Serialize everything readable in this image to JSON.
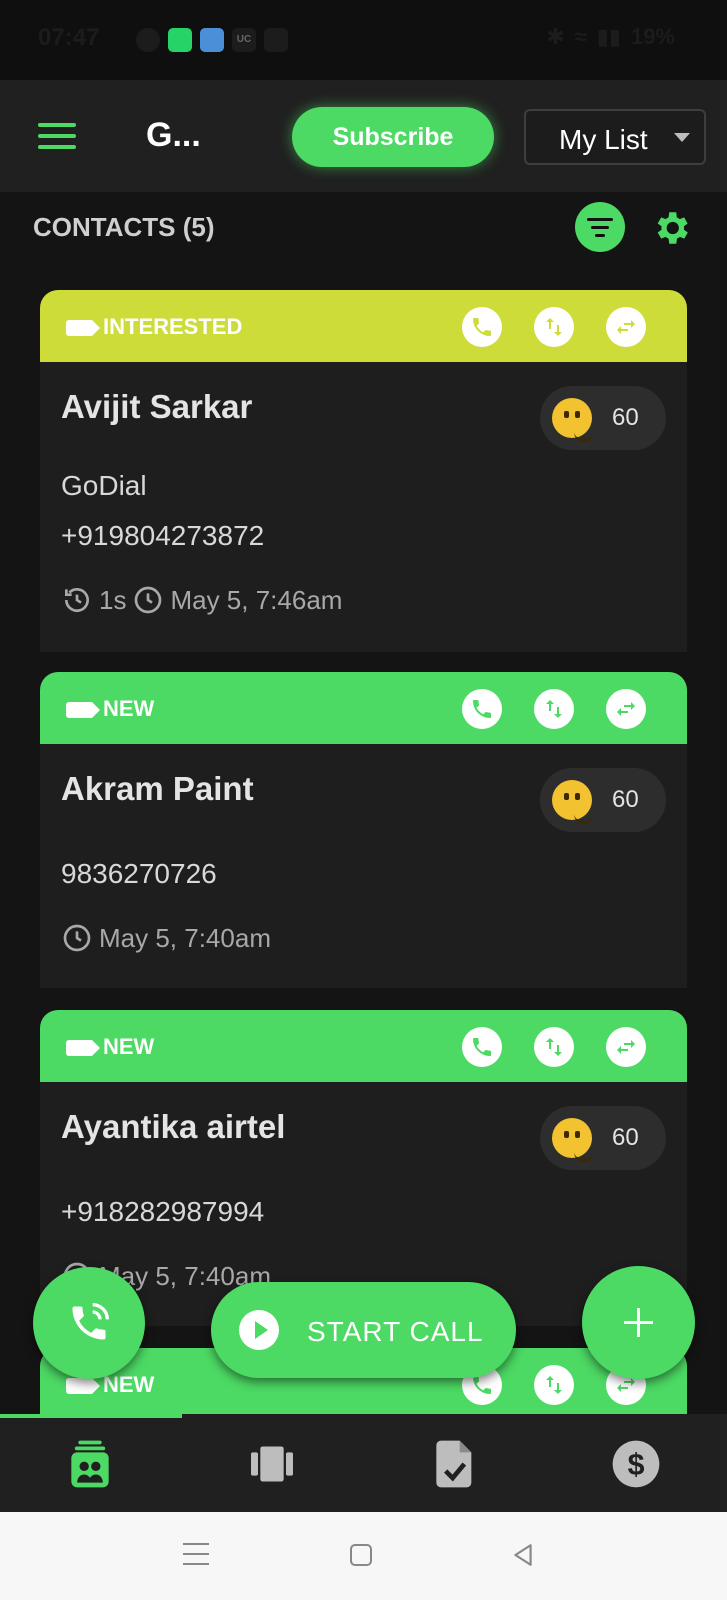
{
  "status_bar": {
    "time": "07:47",
    "notif_icons": [
      "chat-icon",
      "whatsapp-icon",
      "app-icon",
      "uc-icon",
      "plane-icon"
    ],
    "uc_label": "UC",
    "battery": "19%"
  },
  "app_bar": {
    "title": "G...",
    "subscribe_label": "Subscribe",
    "list_selector": "My List"
  },
  "contacts": {
    "header": "CONTACTS (5)"
  },
  "cards": [
    {
      "status": "INTERESTED",
      "status_color": "#cddc39",
      "name": "Avijit Sarkar",
      "score": "60",
      "company": "GoDial",
      "phone": "+919804273872",
      "duration": "1s",
      "date": "May 5, 7:46am"
    },
    {
      "status": "NEW",
      "status_color": "#4cd964",
      "name": "Akram Paint",
      "score": "60",
      "phone": "9836270726",
      "date": "May 5, 7:40am"
    },
    {
      "status": "NEW",
      "status_color": "#4cd964",
      "name": "Ayantika airtel",
      "score": "60",
      "phone": "+918282987994",
      "date": "May 5, 7:40am"
    },
    {
      "status": "NEW",
      "status_color": "#4cd964"
    }
  ],
  "actions": {
    "start_call_label": "START CALL"
  },
  "bottom_nav": {
    "items": [
      "contacts-icon",
      "cards-icon",
      "task-icon",
      "dollar-icon"
    ],
    "active": "contacts-icon"
  },
  "colors": {
    "accent": "#4cd964",
    "interested": "#cddc39",
    "background": "#141414",
    "card": "#1e1e1e"
  }
}
